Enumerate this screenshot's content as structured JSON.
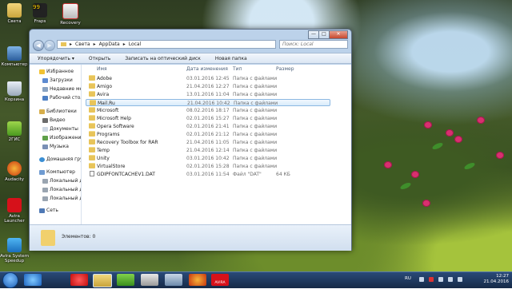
{
  "desktop": {
    "icons": [
      {
        "label": "Света"
      },
      {
        "label": "Fraps",
        "badge": "99"
      },
      {
        "label": "Recovery"
      },
      {
        "label": "Компьютер"
      },
      {
        "label": "Корзина"
      },
      {
        "label": "2ГИС"
      },
      {
        "label": "Audacity"
      },
      {
        "label": "Avira Launcher"
      },
      {
        "label": "Avira System Speedup"
      }
    ]
  },
  "window": {
    "controls": {
      "minimize": "—",
      "maximize": "□",
      "close": "✕"
    },
    "address": {
      "crumbs": [
        "Света",
        "AppData",
        "Local"
      ],
      "sep": "▸"
    },
    "search_placeholder": "Поиск: Local",
    "toolbar": [
      "Упорядочить ▾",
      "Открыть",
      "Записать на оптический диск",
      "Новая папка"
    ],
    "nav": [
      {
        "label": "Избранное",
        "icon": "star-icon"
      },
      {
        "label": "Загрузки",
        "icon": "downloads-icon"
      },
      {
        "label": "Недавние мес",
        "icon": "recent-places-icon"
      },
      {
        "label": "Рабочий стол",
        "icon": "desktop-icon"
      },
      {
        "label": "Библиотеки",
        "icon": "libraries-icon"
      },
      {
        "label": "Видео",
        "icon": "video-icon"
      },
      {
        "label": "Документы",
        "icon": "documents-icon"
      },
      {
        "label": "Изображения",
        "icon": "pictures-icon"
      },
      {
        "label": "Музыка",
        "icon": "music-icon"
      },
      {
        "label": "Домашняя груп",
        "icon": "homegroup-icon"
      },
      {
        "label": "Компьютер",
        "icon": "computer-icon"
      },
      {
        "label": "Локальный ди",
        "icon": "drive-icon"
      },
      {
        "label": "Локальный ди",
        "icon": "drive-icon"
      },
      {
        "label": "Локальный ди",
        "icon": "drive-icon"
      },
      {
        "label": "Сеть",
        "icon": "network-icon"
      }
    ],
    "columns": [
      "Имя",
      "Дата изменения",
      "Тип",
      "Размер"
    ],
    "rows": [
      {
        "name": "Adobe",
        "date": "03.01.2016 12:45",
        "type": "Папка с файлами",
        "size": "",
        "kind": "folder"
      },
      {
        "name": "Amigo",
        "date": "21.04.2016 12:27",
        "type": "Папка с файлами",
        "size": "",
        "kind": "folder"
      },
      {
        "name": "Avira",
        "date": "13.01.2016 11:04",
        "type": "Папка с файлами",
        "size": "",
        "kind": "folder"
      },
      {
        "name": "Mail.Ru",
        "date": "21.04.2016 10:42",
        "type": "Папка с файлами",
        "size": "",
        "kind": "folder"
      },
      {
        "name": "Microsoft",
        "date": "08.02.2016 18:17",
        "type": "Папка с файлами",
        "size": "",
        "kind": "folder"
      },
      {
        "name": "Microsoft Help",
        "date": "02.01.2016 15:27",
        "type": "Папка с файлами",
        "size": "",
        "kind": "folder"
      },
      {
        "name": "Opera Software",
        "date": "02.01.2016 21:41",
        "type": "Папка с файлами",
        "size": "",
        "kind": "folder"
      },
      {
        "name": "Programs",
        "date": "02.01.2016 21:12",
        "type": "Папка с файлами",
        "size": "",
        "kind": "folder"
      },
      {
        "name": "Recovery Toolbox for RAR",
        "date": "21.04.2016 11:05",
        "type": "Папка с файлами",
        "size": "",
        "kind": "folder"
      },
      {
        "name": "Temp",
        "date": "21.04.2016 12:14",
        "type": "Папка с файлами",
        "size": "",
        "kind": "folder"
      },
      {
        "name": "Unity",
        "date": "03.01.2016 10:42",
        "type": "Папка с файлами",
        "size": "",
        "kind": "folder"
      },
      {
        "name": "VirtualStore",
        "date": "02.01.2016 15:28",
        "type": "Папка с файлами",
        "size": "",
        "kind": "folder"
      },
      {
        "name": "GDIPFONTCACHEV1.DAT",
        "date": "03.01.2016 11:54",
        "type": "Файл \"DAT\"",
        "size": "64 КБ",
        "kind": "file"
      }
    ],
    "selected_row": 3,
    "status": "Элементов: 0"
  },
  "taskbar": {
    "apps": [
      "ie-icon",
      "opera-icon",
      "explorer-icon",
      "utorrent-icon",
      "recovery-icon",
      "media-icon",
      "audacity-icon",
      "avira-icon"
    ],
    "avira_label": "AVIRA",
    "language": "RU",
    "time": "12:27",
    "date": "21.04.2016"
  },
  "colors": {
    "selection": "#d9ebfb",
    "folder": "#e8c45a",
    "taskbar": "#1c3356"
  }
}
